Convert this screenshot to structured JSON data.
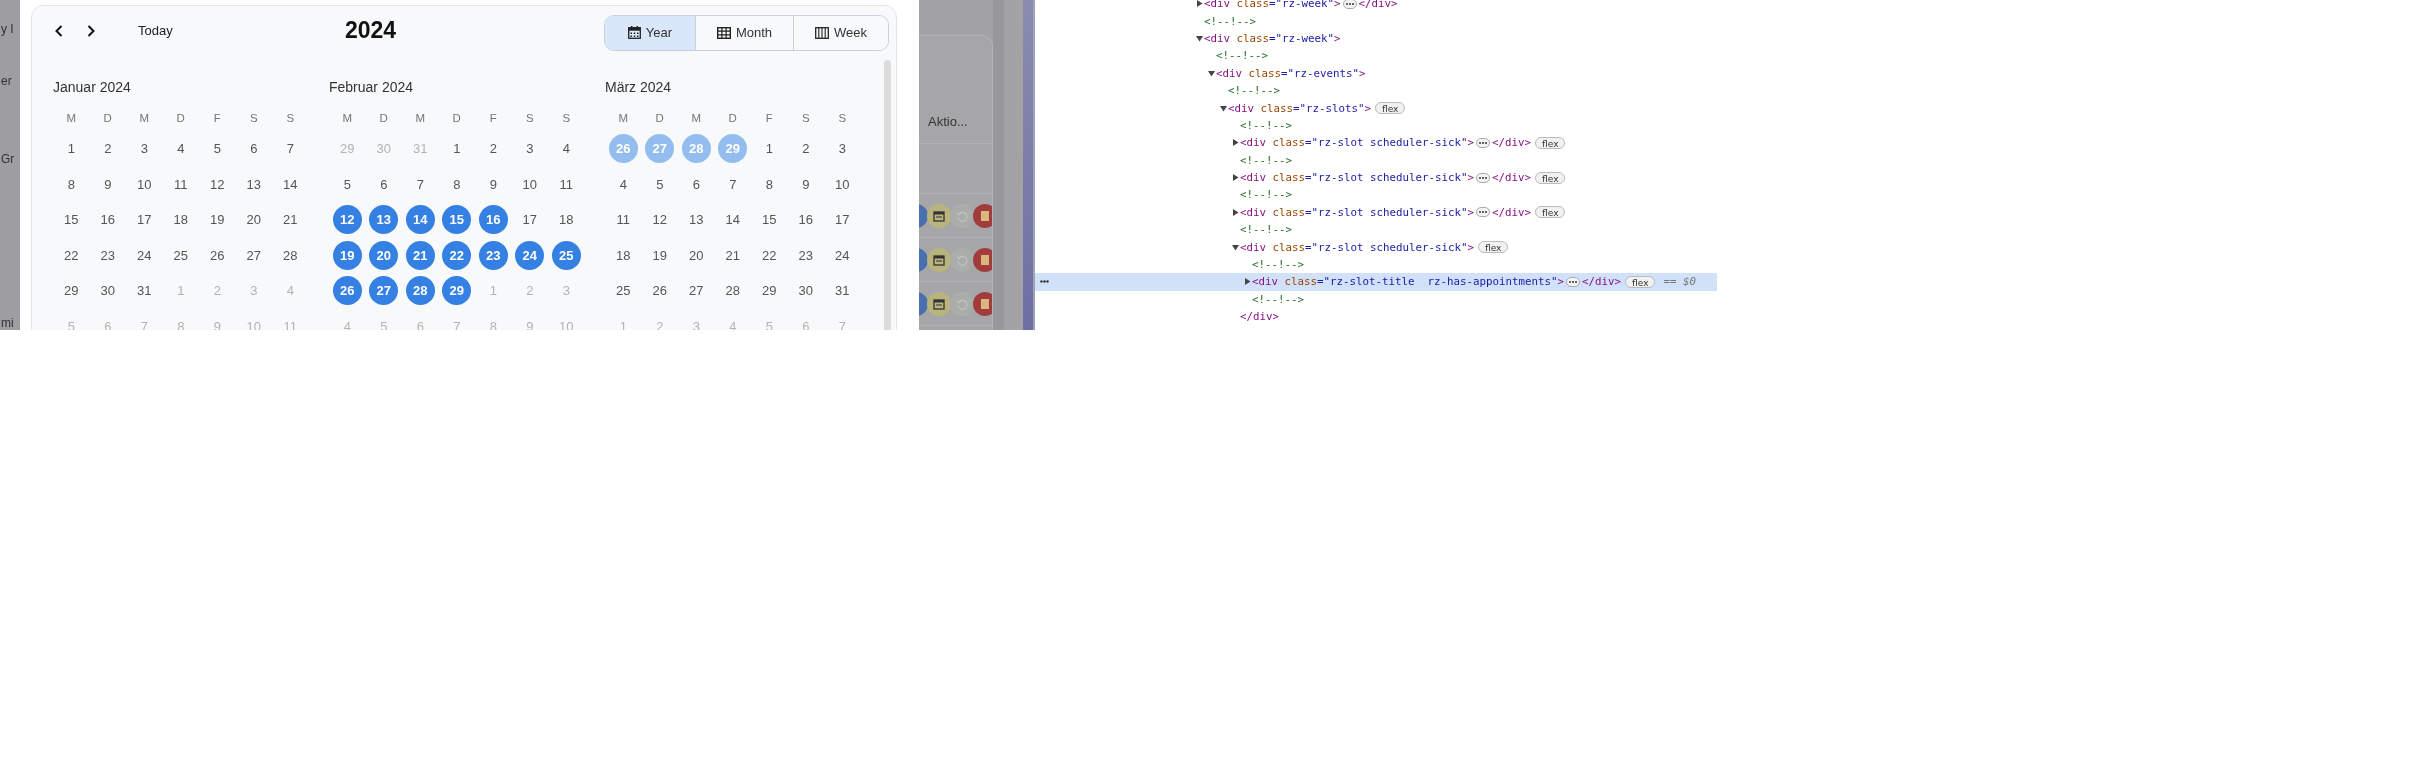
{
  "background_page": {
    "left_fragments": [
      "y I",
      "er",
      "Gr",
      "mi"
    ],
    "table": {
      "column_header": "Aktio...",
      "rows": [
        {
          "actions": [
            {
              "kind": "edit"
            },
            {
              "kind": "calendar"
            },
            {
              "kind": "history"
            },
            {
              "kind": "delete"
            }
          ]
        },
        {
          "actions": [
            {
              "kind": "edit"
            },
            {
              "kind": "calendar"
            },
            {
              "kind": "history"
            },
            {
              "kind": "delete"
            }
          ]
        },
        {
          "actions": [
            {
              "kind": "edit"
            },
            {
              "kind": "calendar"
            },
            {
              "kind": "history"
            },
            {
              "kind": "delete"
            }
          ]
        }
      ]
    }
  },
  "calendar": {
    "today": "Today",
    "title": "2024",
    "views": [
      {
        "kind": "year",
        "label": "Year",
        "selected": true
      },
      {
        "kind": "month",
        "label": "Month",
        "selected": false
      },
      {
        "kind": "week",
        "label": "Week",
        "selected": false
      }
    ],
    "months": [
      {
        "title": "Januar 2024",
        "weekdays": [
          "M",
          "D",
          "M",
          "D",
          "F",
          "S",
          "S"
        ],
        "weeks": [
          [
            {
              "day": "1",
              "outside": false,
              "selected": false
            },
            {
              "day": "2",
              "outside": false,
              "selected": false
            },
            {
              "day": "3",
              "outside": false,
              "selected": false
            },
            {
              "day": "4",
              "outside": false,
              "selected": false
            },
            {
              "day": "5",
              "outside": false,
              "selected": false
            },
            {
              "day": "6",
              "outside": false,
              "selected": false
            },
            {
              "day": "7",
              "outside": false,
              "selected": false
            }
          ],
          [
            {
              "day": "8",
              "outside": false,
              "selected": false
            },
            {
              "day": "9",
              "outside": false,
              "selected": false
            },
            {
              "day": "10",
              "outside": false,
              "selected": false
            },
            {
              "day": "11",
              "outside": false,
              "selected": false
            },
            {
              "day": "12",
              "outside": false,
              "selected": false
            },
            {
              "day": "13",
              "outside": false,
              "selected": false
            },
            {
              "day": "14",
              "outside": false,
              "selected": false
            }
          ],
          [
            {
              "day": "15",
              "outside": false,
              "selected": false
            },
            {
              "day": "16",
              "outside": false,
              "selected": false
            },
            {
              "day": "17",
              "outside": false,
              "selected": false
            },
            {
              "day": "18",
              "outside": false,
              "selected": false
            },
            {
              "day": "19",
              "outside": false,
              "selected": false
            },
            {
              "day": "20",
              "outside": false,
              "selected": false
            },
            {
              "day": "21",
              "outside": false,
              "selected": false
            }
          ],
          [
            {
              "day": "22",
              "outside": false,
              "selected": false
            },
            {
              "day": "23",
              "outside": false,
              "selected": false
            },
            {
              "day": "24",
              "outside": false,
              "selected": false
            },
            {
              "day": "25",
              "outside": false,
              "selected": false
            },
            {
              "day": "26",
              "outside": false,
              "selected": false
            },
            {
              "day": "27",
              "outside": false,
              "selected": false
            },
            {
              "day": "28",
              "outside": false,
              "selected": false
            }
          ],
          [
            {
              "day": "29",
              "outside": false,
              "selected": false
            },
            {
              "day": "30",
              "outside": false,
              "selected": false
            },
            {
              "day": "31",
              "outside": false,
              "selected": false
            },
            {
              "day": "1",
              "outside": true,
              "selected": false
            },
            {
              "day": "2",
              "outside": true,
              "selected": false
            },
            {
              "day": "3",
              "outside": true,
              "selected": false
            },
            {
              "day": "4",
              "outside": true,
              "selected": false
            }
          ],
          [
            {
              "day": "5",
              "outside": true,
              "selected": false
            },
            {
              "day": "6",
              "outside": true,
              "selected": false
            },
            {
              "day": "7",
              "outside": true,
              "selected": false
            },
            {
              "day": "8",
              "outside": true,
              "selected": false
            },
            {
              "day": "9",
              "outside": true,
              "selected": false
            },
            {
              "day": "10",
              "outside": true,
              "selected": false
            },
            {
              "day": "11",
              "outside": true,
              "selected": false
            }
          ]
        ]
      },
      {
        "title": "Februar 2024",
        "weekdays": [
          "M",
          "D",
          "M",
          "D",
          "F",
          "S",
          "S"
        ],
        "weeks": [
          [
            {
              "day": "29",
              "outside": true,
              "selected": false
            },
            {
              "day": "30",
              "outside": true,
              "selected": false
            },
            {
              "day": "31",
              "outside": true,
              "selected": false
            },
            {
              "day": "1",
              "outside": false,
              "selected": false
            },
            {
              "day": "2",
              "outside": false,
              "selected": false
            },
            {
              "day": "3",
              "outside": false,
              "selected": false
            },
            {
              "day": "4",
              "outside": false,
              "selected": false
            }
          ],
          [
            {
              "day": "5",
              "outside": false,
              "selected": false
            },
            {
              "day": "6",
              "outside": false,
              "selected": false
            },
            {
              "day": "7",
              "outside": false,
              "selected": false
            },
            {
              "day": "8",
              "outside": false,
              "selected": false
            },
            {
              "day": "9",
              "outside": false,
              "selected": false
            },
            {
              "day": "10",
              "outside": false,
              "selected": false
            },
            {
              "day": "11",
              "outside": false,
              "selected": false
            }
          ],
          [
            {
              "day": "12",
              "outside": false,
              "selected": true
            },
            {
              "day": "13",
              "outside": false,
              "selected": true
            },
            {
              "day": "14",
              "outside": false,
              "selected": true
            },
            {
              "day": "15",
              "outside": false,
              "selected": true
            },
            {
              "day": "16",
              "outside": false,
              "selected": true
            },
            {
              "day": "17",
              "outside": false,
              "selected": false
            },
            {
              "day": "18",
              "outside": false,
              "selected": false
            }
          ],
          [
            {
              "day": "19",
              "outside": false,
              "selected": true
            },
            {
              "day": "20",
              "outside": false,
              "selected": true
            },
            {
              "day": "21",
              "outside": false,
              "selected": true
            },
            {
              "day": "22",
              "outside": false,
              "selected": true
            },
            {
              "day": "23",
              "outside": false,
              "selected": true
            },
            {
              "day": "24",
              "outside": false,
              "selected": true
            },
            {
              "day": "25",
              "outside": false,
              "selected": true
            }
          ],
          [
            {
              "day": "26",
              "outside": false,
              "selected": true
            },
            {
              "day": "27",
              "outside": false,
              "selected": true
            },
            {
              "day": "28",
              "outside": false,
              "selected": true
            },
            {
              "day": "29",
              "outside": false,
              "selected": true
            },
            {
              "day": "1",
              "outside": true,
              "selected": false
            },
            {
              "day": "2",
              "outside": true,
              "selected": false
            },
            {
              "day": "3",
              "outside": true,
              "selected": false
            }
          ],
          [
            {
              "day": "4",
              "outside": true,
              "selected": false
            },
            {
              "day": "5",
              "outside": true,
              "selected": false
            },
            {
              "day": "6",
              "outside": true,
              "selected": false
            },
            {
              "day": "7",
              "outside": true,
              "selected": false
            },
            {
              "day": "8",
              "outside": true,
              "selected": false
            },
            {
              "day": "9",
              "outside": true,
              "selected": false
            },
            {
              "day": "10",
              "outside": true,
              "selected": false
            }
          ]
        ]
      },
      {
        "title": "März 2024",
        "weekdays": [
          "M",
          "D",
          "M",
          "D",
          "F",
          "S",
          "S"
        ],
        "weeks": [
          [
            {
              "day": "26",
              "outside": true,
              "selected": true
            },
            {
              "day": "27",
              "outside": true,
              "selected": true
            },
            {
              "day": "28",
              "outside": true,
              "selected": true
            },
            {
              "day": "29",
              "outside": true,
              "selected": true
            },
            {
              "day": "1",
              "outside": false,
              "selected": false
            },
            {
              "day": "2",
              "outside": false,
              "selected": false
            },
            {
              "day": "3",
              "outside": false,
              "selected": false
            }
          ],
          [
            {
              "day": "4",
              "outside": false,
              "selected": false
            },
            {
              "day": "5",
              "outside": false,
              "selected": false
            },
            {
              "day": "6",
              "outside": false,
              "selected": false
            },
            {
              "day": "7",
              "outside": false,
              "selected": false
            },
            {
              "day": "8",
              "outside": false,
              "selected": false
            },
            {
              "day": "9",
              "outside": false,
              "selected": false
            },
            {
              "day": "10",
              "outside": false,
              "selected": false
            }
          ],
          [
            {
              "day": "11",
              "outside": false,
              "selected": false
            },
            {
              "day": "12",
              "outside": false,
              "selected": false
            },
            {
              "day": "13",
              "outside": false,
              "selected": false
            },
            {
              "day": "14",
              "outside": false,
              "selected": false
            },
            {
              "day": "15",
              "outside": false,
              "selected": false
            },
            {
              "day": "16",
              "outside": false,
              "selected": false
            },
            {
              "day": "17",
              "outside": false,
              "selected": false
            }
          ],
          [
            {
              "day": "18",
              "outside": false,
              "selected": false
            },
            {
              "day": "19",
              "outside": false,
              "selected": false
            },
            {
              "day": "20",
              "outside": false,
              "selected": false
            },
            {
              "day": "21",
              "outside": false,
              "selected": false
            },
            {
              "day": "22",
              "outside": false,
              "selected": false
            },
            {
              "day": "23",
              "outside": false,
              "selected": false
            },
            {
              "day": "24",
              "outside": false,
              "selected": false
            }
          ],
          [
            {
              "day": "25",
              "outside": false,
              "selected": false
            },
            {
              "day": "26",
              "outside": false,
              "selected": false
            },
            {
              "day": "27",
              "outside": false,
              "selected": false
            },
            {
              "day": "28",
              "outside": false,
              "selected": false
            },
            {
              "day": "29",
              "outside": false,
              "selected": false
            },
            {
              "day": "30",
              "outside": false,
              "selected": false
            },
            {
              "day": "31",
              "outside": false,
              "selected": false
            }
          ],
          [
            {
              "day": "1",
              "outside": true,
              "selected": false
            },
            {
              "day": "2",
              "outside": true,
              "selected": false
            },
            {
              "day": "3",
              "outside": true,
              "selected": false
            },
            {
              "day": "4",
              "outside": true,
              "selected": false
            },
            {
              "day": "5",
              "outside": true,
              "selected": false
            },
            {
              "day": "6",
              "outside": true,
              "selected": false
            },
            {
              "day": "7",
              "outside": true,
              "selected": false
            }
          ]
        ]
      }
    ]
  },
  "devtools": {
    "nodes": [
      {
        "kind": "element",
        "open": "<div",
        "attr_name": " class",
        "attr_value": "=\"rz-week\"",
        "end": ">",
        "expanded": false,
        "selected": false,
        "close": "</div>"
      },
      {
        "kind": "comment",
        "text": "<!--!-->",
        "selected": false
      },
      {
        "kind": "element",
        "open": "<div",
        "attr_name": " class",
        "attr_value": "=\"rz-week\"",
        "end": ">",
        "expanded": true,
        "selected": false,
        "children": [
          {
            "kind": "comment",
            "text": "<!--!-->",
            "selected": false
          },
          {
            "kind": "element",
            "open": "<div",
            "attr_name": " class",
            "attr_value": "=\"rz-events\"",
            "end": ">",
            "expanded": true,
            "selected": false,
            "children": [
              {
                "kind": "comment",
                "text": "<!--!-->",
                "selected": false
              },
              {
                "kind": "element",
                "open": "<div",
                "attr_name": " class",
                "attr_value": "=\"rz-slots\"",
                "end": ">",
                "badge": "flex",
                "expanded": true,
                "selected": false,
                "children": [
                  {
                    "kind": "comment",
                    "text": "<!--!-->",
                    "selected": false
                  },
                  {
                    "kind": "element",
                    "open": "<div",
                    "attr_name": " class",
                    "attr_value": "=\"rz-slot scheduler-sick\"",
                    "end": ">",
                    "badge": "flex",
                    "expanded": false,
                    "selected": false,
                    "close": "</div>"
                  },
                  {
                    "kind": "comment",
                    "text": "<!--!-->",
                    "selected": false
                  },
                  {
                    "kind": "element",
                    "open": "<div",
                    "attr_name": " class",
                    "attr_value": "=\"rz-slot scheduler-sick\"",
                    "end": ">",
                    "badge": "flex",
                    "expanded": false,
                    "selected": false,
                    "close": "</div>"
                  },
                  {
                    "kind": "comment",
                    "text": "<!--!-->",
                    "selected": false
                  },
                  {
                    "kind": "element",
                    "open": "<div",
                    "attr_name": " class",
                    "attr_value": "=\"rz-slot scheduler-sick\"",
                    "end": ">",
                    "badge": "flex",
                    "expanded": false,
                    "selected": false,
                    "close": "</div>"
                  },
                  {
                    "kind": "comment",
                    "text": "<!--!-->",
                    "selected": false
                  },
                  {
                    "kind": "element",
                    "open": "<div",
                    "attr_name": " class",
                    "attr_value": "=\"rz-slot scheduler-sick\"",
                    "end": ">",
                    "badge": "flex",
                    "expanded": true,
                    "selected": false,
                    "close": "</div>",
                    "children": [
                      {
                        "kind": "comment",
                        "text": "<!--!-->",
                        "selected": false
                      },
                      {
                        "kind": "element",
                        "open": "<div",
                        "attr_name": " class",
                        "attr_value": "=\"rz-slot-title  rz-has-appointments\"",
                        "end": ">",
                        "badge": "flex",
                        "expanded": false,
                        "selected": true,
                        "close": "</div>",
                        "reference": "== $0"
                      },
                      {
                        "kind": "comment",
                        "text": "<!--!-->",
                        "selected": false
                      }
                    ]
                  }
                ]
              }
            ]
          }
        ]
      }
    ]
  }
}
